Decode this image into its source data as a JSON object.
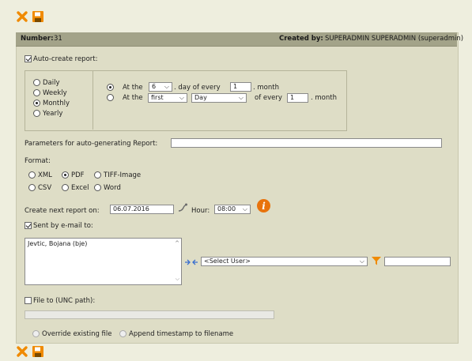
{
  "toolbar": {
    "close_icon": "close-icon",
    "save_icon": "save-icon"
  },
  "header": {
    "number_label": "Number:",
    "number_value": "31",
    "created_by_label": "Created by:",
    "created_by_value": "SUPERADMIN SUPERADMIN (superadmin)"
  },
  "auto_create": {
    "label": "Auto-create report:",
    "checked": true,
    "frequency": [
      {
        "label": "Daily",
        "checked": false
      },
      {
        "label": "Weekly",
        "checked": false
      },
      {
        "label": "Monthly",
        "checked": true
      },
      {
        "label": "Yearly",
        "checked": false
      }
    ],
    "option1": {
      "prefix": "At the",
      "day_value": "6",
      "middle": ". day of every",
      "month_value": "1",
      "suffix": ". month"
    },
    "option2": {
      "prefix": "At the",
      "first_value": "first",
      "day_value": "Day",
      "middle": "of every",
      "month_value": "1",
      "suffix": ". month"
    }
  },
  "parameters": {
    "label": "Parameters for auto-generating Report:",
    "value": ""
  },
  "format": {
    "label": "Format:",
    "options": [
      {
        "label": "XML",
        "checked": false
      },
      {
        "label": "PDF",
        "checked": true
      },
      {
        "label": "TIFF-Image",
        "checked": false
      },
      {
        "label": "CSV",
        "checked": false
      },
      {
        "label": "Excel",
        "checked": false
      },
      {
        "label": "Word",
        "checked": false
      }
    ]
  },
  "next_report": {
    "label": "Create next report on:",
    "date": "06.07.2016",
    "hour_label": "Hour:",
    "hour_value": "08:00"
  },
  "email": {
    "label": "Sent by e-mail to:",
    "checked": true,
    "recipients": [
      "Jevtic, Bojana (bje)"
    ],
    "select_user": "<Select User>",
    "filter_value": ""
  },
  "file": {
    "label": "File to (UNC path):",
    "checked": false,
    "path": "",
    "override_label": "Override existing file",
    "append_label": "Append timestamp to filename"
  },
  "colors": {
    "header_bg": "#a3a389",
    "panel_bg": "#deddc6",
    "icon_orange": "#f08a00",
    "info_orange": "#e8730c"
  }
}
